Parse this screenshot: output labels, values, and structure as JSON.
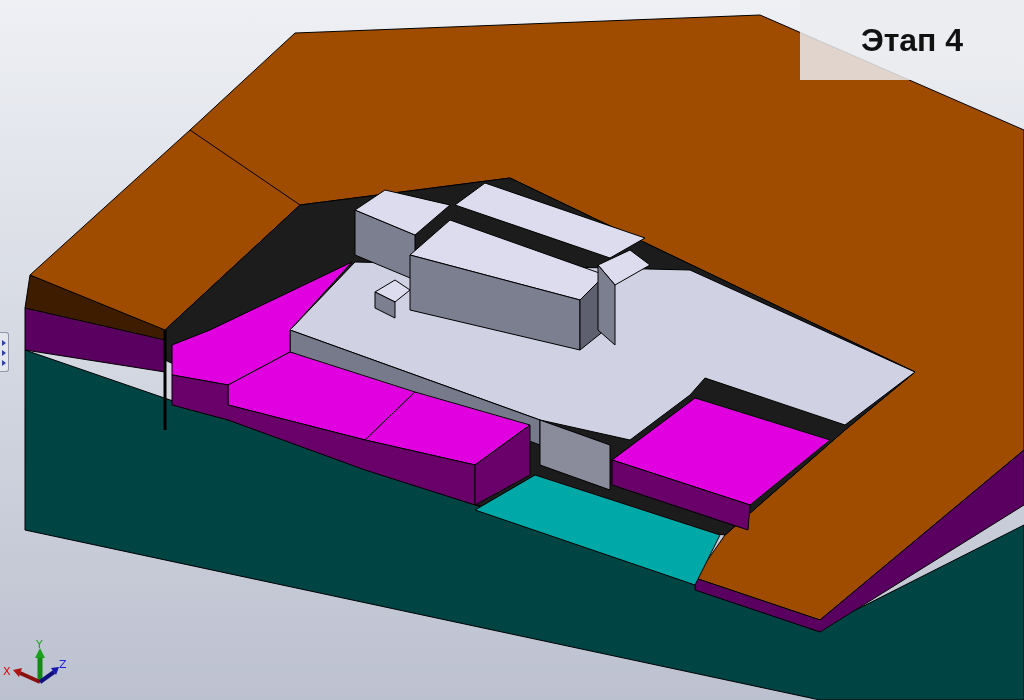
{
  "stage_label": "Этап 4",
  "triad": {
    "x_label": "X",
    "y_label": "Y",
    "z_label": "Z"
  }
}
